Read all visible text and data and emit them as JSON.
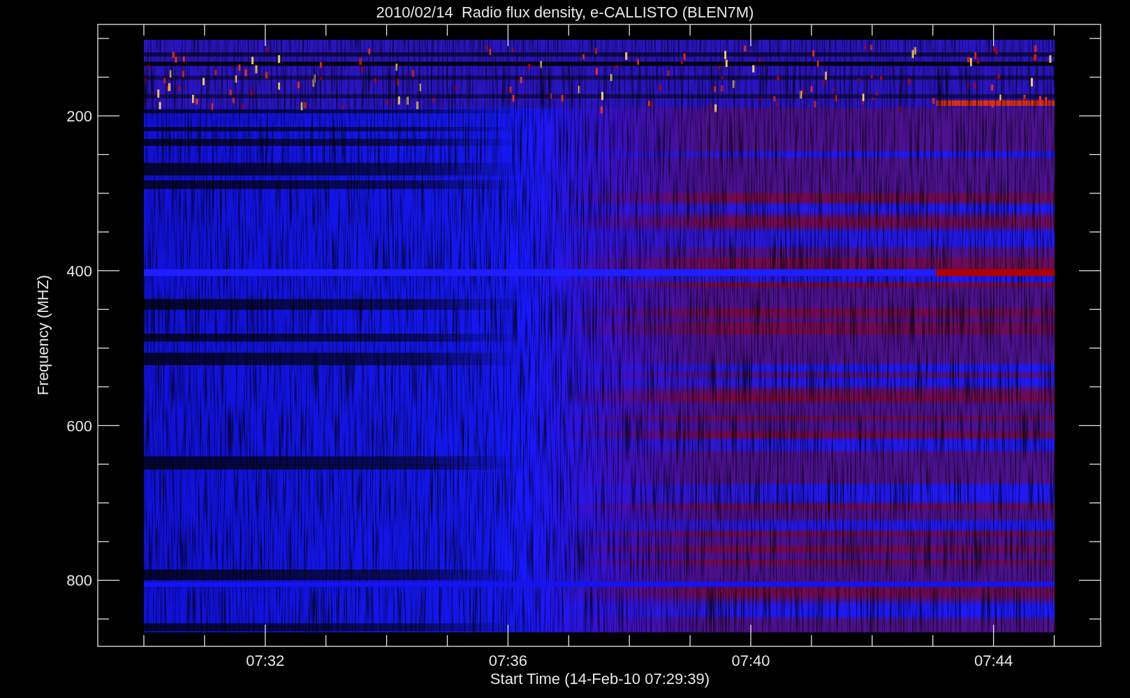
{
  "title": "2010/02/14  Radio flux density, e-CALLISTO (BLEN7M)",
  "y_axis": {
    "label": "Frequency (MHZ)",
    "tick_labels": [
      "200",
      "400",
      "600",
      "800"
    ]
  },
  "x_axis": {
    "label": "Start Time (14-Feb-10 07:29:39)",
    "tick_labels": [
      "07:32",
      "07:36",
      "07:40",
      "07:44"
    ]
  }
}
